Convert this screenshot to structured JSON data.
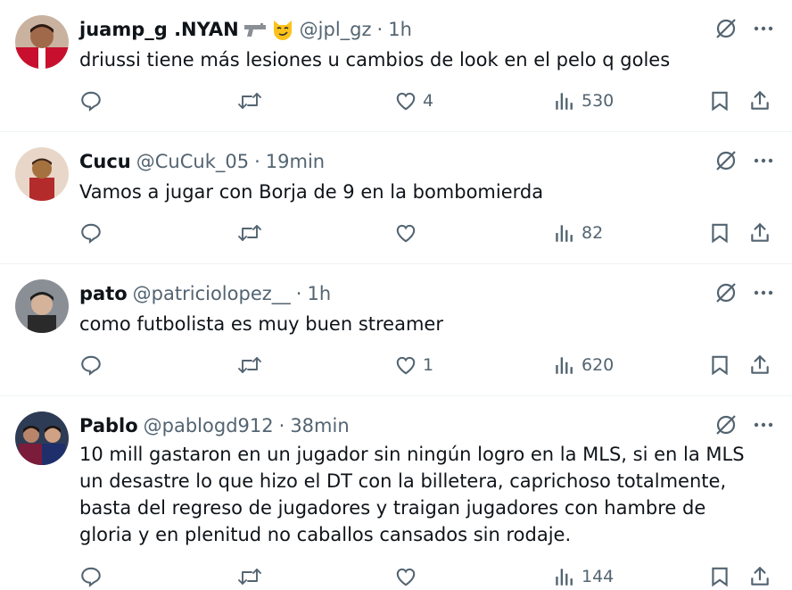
{
  "tweets": [
    {
      "name": "juamp_g .NYAN",
      "emoji_icons": [
        "pistol-icon",
        "smirking-cat-icon"
      ],
      "handle": "@jpl_gz",
      "time": "1h",
      "text": "driussi tiene más lesiones u cambios de look en el pelo q goles",
      "reply_count": "",
      "retweet_count": "",
      "like_count": "4",
      "view_count": "530"
    },
    {
      "name": "Cucu",
      "handle": "@CuCuk_05",
      "time": "19min",
      "text": "Vamos a jugar con Borja de 9 en la bombomierda",
      "reply_count": "",
      "retweet_count": "",
      "like_count": "",
      "view_count": "82"
    },
    {
      "name": "pato",
      "handle": "@patriciolopez__",
      "time": "1h",
      "text": "como futbolista es muy buen streamer",
      "reply_count": "",
      "retweet_count": "",
      "like_count": "1",
      "view_count": "620"
    },
    {
      "name": "Pablo",
      "handle": "@pablogd912",
      "time": "38min",
      "text": "10 mill gastaron en un jugador sin ningún logro en la MLS, si en la MLS un desastre lo que hizo el DT con la billetera, caprichoso totalmente, basta del regreso de jugadores y traigan jugadores con hambre de gloria y en plenitud no caballos cansados sin rodaje.",
      "reply_count": "",
      "retweet_count": "",
      "like_count": "",
      "view_count": "144"
    }
  ],
  "separator": "·",
  "colors": {
    "text": "#0f1419",
    "secondary": "#536471",
    "border": "#eff3f4"
  }
}
